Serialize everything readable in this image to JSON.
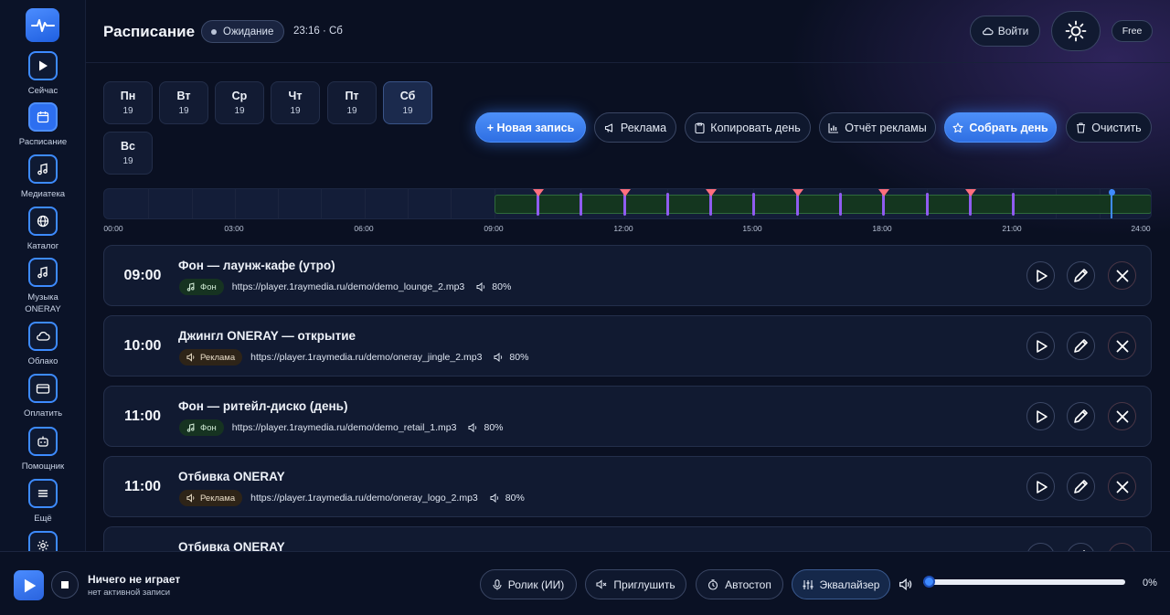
{
  "sidebar": {
    "logo_icon": "pulse-logo",
    "items": [
      {
        "label": "Сейчас",
        "icon": "play-icon",
        "active": false
      },
      {
        "label": "Расписание",
        "icon": "calendar-icon",
        "active": true
      },
      {
        "label": "Медиатека",
        "icon": "music-note-icon",
        "active": false
      },
      {
        "label": "Каталог",
        "icon": "globe-icon",
        "active": false
      },
      {
        "label": "Музыка ONERAY",
        "icon": "music-note-icon",
        "active": false
      },
      {
        "label": "Облако",
        "icon": "cloud-icon",
        "active": false
      },
      {
        "label": "Оплатить",
        "icon": "card-icon",
        "active": false
      },
      {
        "label": "Помощник",
        "icon": "robot-icon",
        "active": false
      },
      {
        "label": "Ещё",
        "icon": "menu-icon",
        "active": false
      }
    ]
  },
  "header": {
    "title": "Расписание",
    "status": "Ожидание",
    "clock": "23:16 · Сб",
    "login_label": "Войти",
    "plan_badge": "Free"
  },
  "days": [
    {
      "name": "Пн",
      "num": "19",
      "active": false
    },
    {
      "name": "Вт",
      "num": "19",
      "active": false
    },
    {
      "name": "Ср",
      "num": "19",
      "active": false
    },
    {
      "name": "Чт",
      "num": "19",
      "active": false
    },
    {
      "name": "Пт",
      "num": "19",
      "active": false
    },
    {
      "name": "Сб",
      "num": "19",
      "active": true
    },
    {
      "name": "Вс",
      "num": "19",
      "active": false
    }
  ],
  "actions": {
    "new_entry": "+ Новая запись",
    "ads": "Реклама",
    "copy_day": "Копировать день",
    "ad_report": "Отчёт рекламы",
    "build_day": "Собрать день",
    "clear": "Очистить"
  },
  "timeline": {
    "labels": [
      "00:00",
      "03:00",
      "06:00",
      "09:00",
      "12:00",
      "15:00",
      "18:00",
      "21:00",
      "24:00"
    ],
    "active_range_hours": [
      9,
      24
    ],
    "track_hours": [
      10,
      11,
      12,
      13,
      14,
      15,
      16,
      17,
      18,
      19,
      20,
      21
    ],
    "ad_marker_hours": [
      10,
      12,
      14,
      16,
      18,
      20
    ],
    "now_hour": 23.27,
    "colors": {
      "track": "#8f5cf0",
      "ad": "#ff6f7d",
      "now": "#3f8bff",
      "active_bg": "#14361f"
    }
  },
  "entries": [
    {
      "time": "09:00",
      "title": "Фон — лаунж-кафе (утро)",
      "tag": "Фон",
      "type": "bg",
      "url": "https://player.1raymedia.ru/demo/demo_lounge_2.mp3",
      "volume": "80%"
    },
    {
      "time": "10:00",
      "title": "Джингл ONERAY — открытие",
      "tag": "Реклама",
      "type": "ad",
      "url": "https://player.1raymedia.ru/demo/oneray_jingle_2.mp3",
      "volume": "80%"
    },
    {
      "time": "11:00",
      "title": "Фон — ритейл-диско (день)",
      "tag": "Фон",
      "type": "bg",
      "url": "https://player.1raymedia.ru/demo/demo_retail_1.mp3",
      "volume": "80%"
    },
    {
      "time": "11:00",
      "title": "Отбивка ONERAY",
      "tag": "Реклама",
      "type": "ad",
      "url": "https://player.1raymedia.ru/demo/oneray_logo_2.mp3",
      "volume": "80%"
    },
    {
      "time": "",
      "title": "Отбивка ONERAY",
      "tag": "",
      "type": "ad",
      "url": "",
      "volume": ""
    }
  ],
  "player": {
    "title": "Ничего не играет",
    "subtitle": "нет активной записи",
    "ai_clip": "Ролик (ИИ)",
    "mute": "Приглушить",
    "autostop": "Автостоп",
    "equalizer": "Эквалайзер",
    "volume_value": 0,
    "volume_label": "0%"
  }
}
